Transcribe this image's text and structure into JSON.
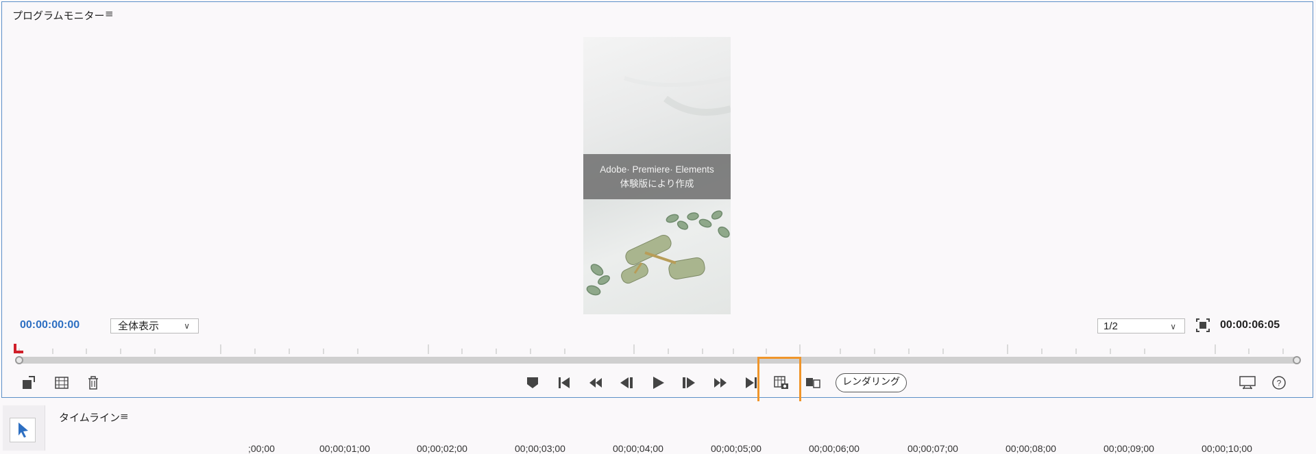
{
  "monitor": {
    "title": "プログラムモニター",
    "menu_icon": "hamburger-icon",
    "watermark": {
      "line1": "Adobe· Premiere· Elements",
      "line2": "体験版により作成"
    },
    "current_timecode": "00:00:00:00",
    "zoom_select": "全体表示",
    "resolution_select": "1/2",
    "duration_timecode": "00:00:06:05",
    "render_button": "レンダリング"
  },
  "controls": {
    "left": [
      "export-frame-icon",
      "freeze-frame-icon",
      "delete-icon"
    ],
    "center": [
      "marker-icon",
      "go-to-start-icon",
      "rewind-icon",
      "step-back-icon",
      "play-icon",
      "step-forward-icon",
      "fast-forward-icon",
      "go-to-end-icon",
      "freeze-frame-snapshot-icon",
      "split-clip-icon"
    ],
    "right": [
      "output-display-icon",
      "help-icon"
    ]
  },
  "timeline": {
    "title": "タイムライン",
    "menu_icon": "hamburger-icon",
    "tool": "selection-tool-icon",
    "ticks": [
      ";00;00",
      "00;00;01;00",
      "00;00;02;00",
      "00;00;03;00",
      "00;00;04;00",
      "00;00;05;00",
      "00;00;06;00",
      "00;00;07;00",
      "00;00;08;00",
      "00;00;09;00",
      "00;00;10;00"
    ]
  },
  "colors": {
    "accent_blue": "#2d6fc2",
    "highlight_orange": "#f0952a",
    "playhead_red": "#d01f2a",
    "panel_border": "#5b8fc7"
  }
}
